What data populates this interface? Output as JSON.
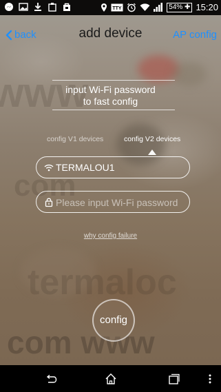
{
  "status_bar": {
    "time": "15:20",
    "battery_percent": "54%",
    "icons": [
      "messenger-icon",
      "image-icon",
      "download-icon",
      "clipboard-icon",
      "bag-icon",
      "location-icon",
      "tty-icon",
      "alarm-icon",
      "wifi-icon",
      "signal-icon",
      "battery-icon"
    ]
  },
  "header": {
    "back_label": "back",
    "title": "add device",
    "ap_config_label": "AP config"
  },
  "instructions": {
    "line1": "input Wi-Fi password",
    "line2": "to fast config"
  },
  "tabs": {
    "v1_label": "config V1 devices",
    "v2_label": "config V2 devices",
    "active": "v2"
  },
  "form": {
    "ssid_value": "TERMALOU1",
    "password_placeholder": "Please input Wi-Fi password",
    "why_link": "why config failure",
    "config_button": "config"
  },
  "watermark_text": {
    "lines": [
      "www",
      "termaloc",
      "com",
      "com  www"
    ]
  },
  "nav_bar": {
    "icons": [
      "back-nav-icon",
      "home-nav-icon",
      "recent-apps-icon",
      "overflow-menu-icon"
    ]
  },
  "colors": {
    "accent": "#1e90ff",
    "status_bar_bg": "#000000",
    "text_light": "#ffffff"
  }
}
